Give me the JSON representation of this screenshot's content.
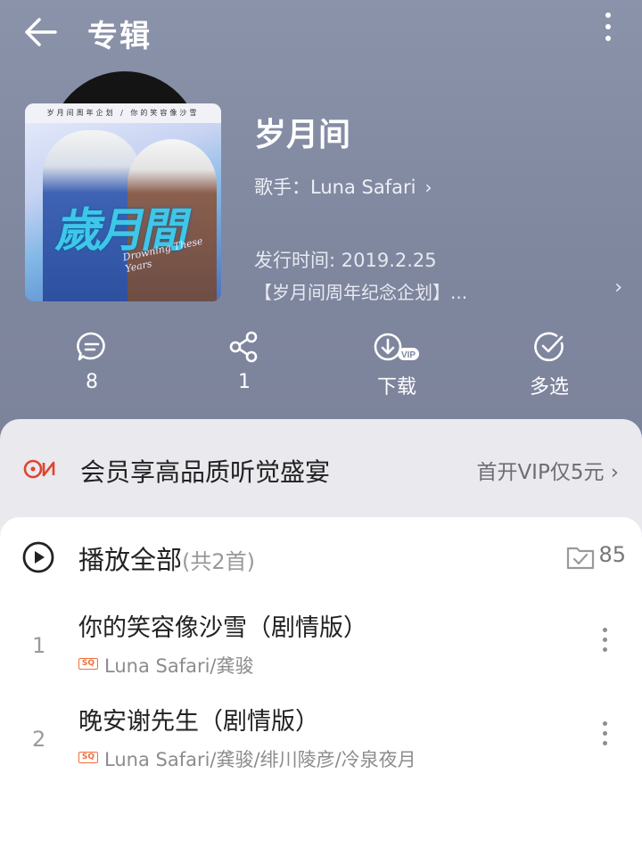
{
  "header": {
    "title": "专辑",
    "back_icon": "arrow-left-icon",
    "more_icon": "more-vertical-icon"
  },
  "album": {
    "cover_banner": "岁月间周年企划 / 你的笑容像沙雪",
    "cover_title": "歲月間",
    "cover_subtitle": "Drowning These Years",
    "name": "岁月间",
    "artist_label": "歌手：Luna Safari",
    "release": "发行时间: 2019.2.25",
    "description": "【岁月间周年纪念企划】..."
  },
  "actions": [
    {
      "icon": "comment-icon",
      "label": "8"
    },
    {
      "icon": "share-icon",
      "label": "1"
    },
    {
      "icon": "download-vip-icon",
      "label": "下载"
    },
    {
      "icon": "multi-select-icon",
      "label": "多选"
    }
  ],
  "vip": {
    "logo_text": "VIP",
    "text": "会员享高品质听觉盛宴",
    "offer": "首开VIP仅5元"
  },
  "playlist": {
    "play_all": "播放全部",
    "count": "(共2首)",
    "collect_count": "85"
  },
  "songs": [
    {
      "index": "1",
      "title": "你的笑容像沙雪（剧情版）",
      "quality": "SQ",
      "artist": "Luna Safari/龚骏"
    },
    {
      "index": "2",
      "title": "晚安谢先生（剧情版）",
      "quality": "SQ",
      "artist": "Luna Safari/龚骏/绯川陵彦/冷泉夜月"
    }
  ],
  "colors": {
    "header_bg": "#8b93aa",
    "vip_accent": "#e0452c",
    "sq_badge": "#f26f3a"
  }
}
